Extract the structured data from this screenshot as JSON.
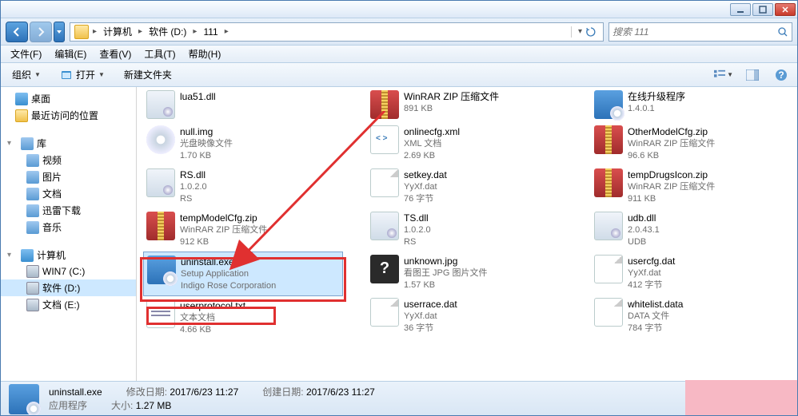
{
  "titlebar": {
    "min": "",
    "max": "",
    "close": ""
  },
  "breadcrumb": {
    "items": [
      "计算机",
      "软件 (D:)",
      "111"
    ]
  },
  "search": {
    "placeholder": "搜索 111"
  },
  "menubar": [
    "文件(F)",
    "编辑(E)",
    "查看(V)",
    "工具(T)",
    "帮助(H)"
  ],
  "toolbar": {
    "organize": "组织",
    "open": "打开",
    "new_folder": "新建文件夹"
  },
  "sidebar": {
    "desktop": "桌面",
    "recent": "最近访问的位置",
    "library": "库",
    "videos": "视频",
    "pictures": "图片",
    "documents": "文档",
    "xunlei": "迅雷下载",
    "music": "音乐",
    "computer": "计算机",
    "win7": "WIN7 (C:)",
    "software": "软件 (D:)",
    "docs_e": "文档 (E:)"
  },
  "files_col1": [
    {
      "name": "lua51.dll",
      "meta1": "",
      "meta2": "",
      "icon": "dll"
    },
    {
      "name": "null.img",
      "meta1": "光盘映像文件",
      "meta2": "1.70 KB",
      "icon": "img-disc"
    },
    {
      "name": "RS.dll",
      "meta1": "1.0.2.0",
      "meta2": "RS",
      "icon": "dll"
    },
    {
      "name": "tempModelCfg.zip",
      "meta1": "WinRAR ZIP 压缩文件",
      "meta2": "912 KB",
      "icon": "archive"
    },
    {
      "name": "uninstall.exe",
      "meta1": "Setup Application",
      "meta2": "Indigo Rose Corporation",
      "icon": "setup",
      "selected": true
    },
    {
      "name": "userprotocol.txt",
      "meta1": "文本文档",
      "meta2": "4.66 KB",
      "icon": "doc-txt"
    }
  ],
  "files_col2": [
    {
      "name": "WinRAR ZIP 压缩文件",
      "meta1": "891 KB",
      "meta2": "",
      "icon": "archive"
    },
    {
      "name": "onlinecfg.xml",
      "meta1": "XML 文档",
      "meta2": "2.69 KB",
      "icon": "xml"
    },
    {
      "name": "setkey.dat",
      "meta1": "YyXf.dat",
      "meta2": "76 字节",
      "icon": "doc-blank"
    },
    {
      "name": "TS.dll",
      "meta1": "1.0.2.0",
      "meta2": "RS",
      "icon": "dll"
    },
    {
      "name": "unknown.jpg",
      "meta1": "看图王 JPG 图片文件",
      "meta2": "1.57 KB",
      "icon": "unknown"
    },
    {
      "name": "userrace.dat",
      "meta1": "YyXf.dat",
      "meta2": "36 字节",
      "icon": "doc-blank"
    }
  ],
  "files_col3": [
    {
      "name": "在线升级程序",
      "meta1": "1.4.0.1",
      "meta2": "",
      "icon": "setup"
    },
    {
      "name": "OtherModelCfg.zip",
      "meta1": "WinRAR ZIP 压缩文件",
      "meta2": "96.6 KB",
      "icon": "archive"
    },
    {
      "name": "tempDrugsIcon.zip",
      "meta1": "WinRAR ZIP 压缩文件",
      "meta2": "911 KB",
      "icon": "archive"
    },
    {
      "name": "udb.dll",
      "meta1": "2.0.43.1",
      "meta2": "UDB",
      "icon": "dll"
    },
    {
      "name": "usercfg.dat",
      "meta1": "YyXf.dat",
      "meta2": "412 字节",
      "icon": "doc-blank"
    },
    {
      "name": "whitelist.data",
      "meta1": "DATA 文件",
      "meta2": "784 字节",
      "icon": "doc-blank"
    }
  ],
  "status": {
    "filename": "uninstall.exe",
    "filetype": "应用程序",
    "mod_label": "修改日期:",
    "mod_value": "2017/6/23 11:27",
    "created_label": "创建日期:",
    "created_value": "2017/6/23 11:27",
    "size_label": "大小:",
    "size_value": "1.27 MB"
  }
}
